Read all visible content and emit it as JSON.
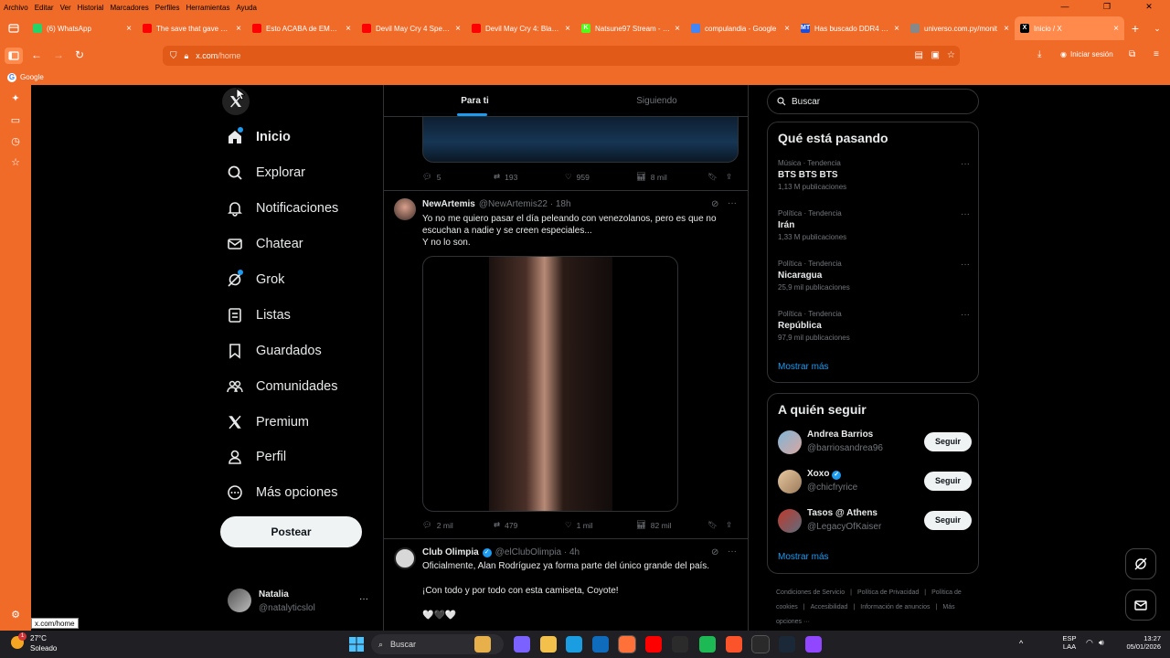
{
  "menu": [
    "Archivo",
    "Editar",
    "Ver",
    "Historial",
    "Marcadores",
    "Perfiles",
    "Herramientas",
    "Ayuda"
  ],
  "tabs": [
    {
      "title": "(6) WhatsApp",
      "color": "#25d366",
      "glyph": "",
      "active": false
    },
    {
      "title": "The save that gave City",
      "color": "#ff0000",
      "glyph": "",
      "active": false
    },
    {
      "title": "Esto ACABA de EMPEZAR",
      "color": "#ff0000",
      "glyph": "",
      "active": false
    },
    {
      "title": "Devil May Cry 4 Special",
      "color": "#ff0000",
      "glyph": "",
      "active": false
    },
    {
      "title": "Devil May Cry 4: Blacke",
      "color": "#ff0000",
      "glyph": "",
      "active": false
    },
    {
      "title": "Natsune97 Stream - Wa",
      "color": "#53fc18",
      "glyph": "K",
      "active": false
    },
    {
      "title": "compulandia - Google",
      "color": "#4285f4",
      "glyph": "",
      "active": false
    },
    {
      "title": "Has buscado DDR4 - P",
      "color": "#1d4ed8",
      "glyph": "MT",
      "active": false
    },
    {
      "title": "universo.com.py/monit",
      "color": "#888888",
      "glyph": "",
      "active": false
    },
    {
      "title": "Inicio / X",
      "color": "#000000",
      "glyph": "X",
      "active": true
    }
  ],
  "url": {
    "domain": "x.com",
    "path": "/home"
  },
  "signin": "Iniciar sesión",
  "bookmark": "Google",
  "nav": [
    {
      "label": "Inicio",
      "icon": "home-icon"
    },
    {
      "label": "Explorar",
      "icon": "search-icon"
    },
    {
      "label": "Notificaciones",
      "icon": "bell-icon"
    },
    {
      "label": "Chatear",
      "icon": "mail-icon"
    },
    {
      "label": "Grok",
      "icon": "grok-icon"
    },
    {
      "label": "Listas",
      "icon": "list-icon"
    },
    {
      "label": "Guardados",
      "icon": "bookmark-icon"
    },
    {
      "label": "Comunidades",
      "icon": "communities-icon"
    },
    {
      "label": "Premium",
      "icon": "x-icon"
    },
    {
      "label": "Perfil",
      "icon": "person-icon"
    },
    {
      "label": "Más opciones",
      "icon": "more-circle-icon"
    }
  ],
  "post_label": "Postear",
  "account": {
    "name": "Natalia",
    "handle": "@natalyticslol"
  },
  "hometabs": {
    "for_you": "Para ti",
    "following": "Siguiendo"
  },
  "tweet0_actions": {
    "replies": "5",
    "reposts": "193",
    "likes": "959",
    "views": "8 mil"
  },
  "tweet1": {
    "name": "NewArtemis",
    "handle": "@NewArtemis22 · 18h",
    "line1": "Yo no me quiero pasar el día peleando con venezolanos, pero es que no",
    "line2": "escuchan a nadie y se creen especiales...",
    "line3": "Y no lo son.",
    "actions": {
      "replies": "2 mil",
      "reposts": "479",
      "likes": "1 mil",
      "views": "82 mil"
    }
  },
  "tweet2": {
    "name": "Club Olimpia",
    "handle": "@elClubOlimpia · 4h",
    "line1": "Oficialmente, Alan Rodríguez ya forma parte del único grande del país.",
    "line2": "¡Con todo y por todo con esta camiseta, Coyote!",
    "line3": "🤍🖤🤍"
  },
  "search_placeholder": "Buscar",
  "trends_title": "Qué está pasando",
  "trends": [
    {
      "cat": "Música · Tendencia",
      "name": "BTS BTS BTS",
      "count": "1,13 M publicaciones"
    },
    {
      "cat": "Política · Tendencia",
      "name": "Irán",
      "count": "1,33 M publicaciones"
    },
    {
      "cat": "Política · Tendencia",
      "name": "Nicaragua",
      "count": "25,9 mil publicaciones"
    },
    {
      "cat": "Política · Tendencia",
      "name": "República",
      "count": "97,9 mil publicaciones"
    }
  ],
  "show_more": "Mostrar más",
  "follow_title": "A quién seguir",
  "follows": [
    {
      "name": "Andrea Barrios",
      "handle": "@barriosandrea96",
      "btn": "Seguir",
      "verified": false
    },
    {
      "name": "Xoxo",
      "handle": "@chicfryrice",
      "btn": "Seguir",
      "verified": true
    },
    {
      "name": "Tasos @ Athens",
      "handle": "@LegacyOfKaiser",
      "btn": "Seguir",
      "verified": false
    }
  ],
  "footer": [
    "Condiciones de Servicio",
    "|",
    "Política de Privacidad",
    "|",
    "Política de cookies",
    "|",
    "Accesibilidad",
    "|",
    "Información de anuncios",
    "|",
    "Más opciones ···"
  ],
  "status_url": "x.com/home",
  "weather": {
    "temp": "27°C",
    "desc": "Soleado",
    "badge": "1"
  },
  "taskbar_search": "Buscar",
  "tray": {
    "lang1": "ESP",
    "lang2": "LAA",
    "time": "13:27",
    "date": "05/01/2026"
  },
  "colors": {
    "accent": "#1d9bf0",
    "browser": "#f06a28"
  }
}
